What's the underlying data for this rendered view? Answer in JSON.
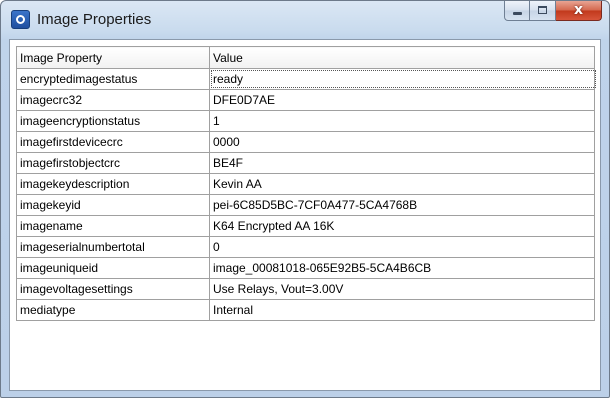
{
  "window": {
    "title": "Image Properties",
    "icon": "app-icon",
    "buttons": {
      "minimize": "minimize",
      "maximize": "maximize",
      "close": "x"
    }
  },
  "table": {
    "columns": [
      "Image Property",
      "Value"
    ],
    "rows": [
      {
        "property": "encryptedimagestatus",
        "value": "ready"
      },
      {
        "property": "imagecrc32",
        "value": "DFE0D7AE"
      },
      {
        "property": "imageencryptionstatus",
        "value": "1"
      },
      {
        "property": "imagefirstdevicecrc",
        "value": "0000"
      },
      {
        "property": "imagefirstobjectcrc",
        "value": "BE4F"
      },
      {
        "property": "imagekeydescription",
        "value": "Kevin AA"
      },
      {
        "property": "imagekeyid",
        "value": "pei-6C85D5BC-7CF0A477-5CA4768B"
      },
      {
        "property": "imagename",
        "value": "K64 Encrypted AA 16K"
      },
      {
        "property": "imageserialnumbertotal",
        "value": "0"
      },
      {
        "property": "imageuniqueid",
        "value": "image_00081018-065E92B5-5CA4B6CB"
      },
      {
        "property": "imagevoltagesettings",
        "value": "Use Relays, Vout=3.00V"
      },
      {
        "property": "mediatype",
        "value": "Internal"
      }
    ]
  }
}
